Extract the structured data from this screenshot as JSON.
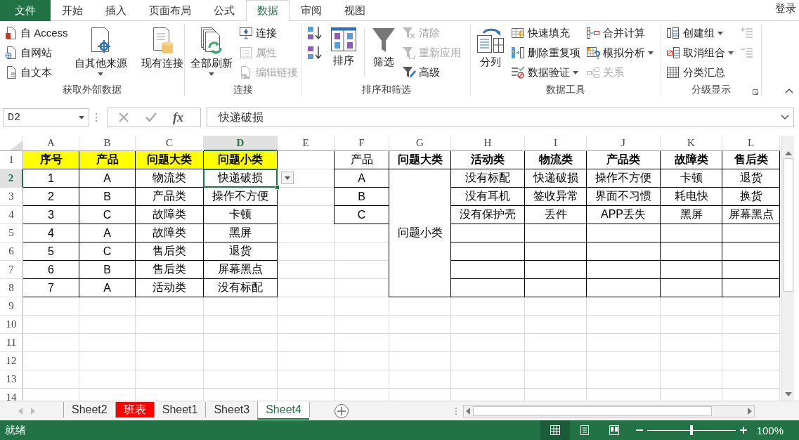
{
  "ribbon": {
    "tabs": [
      {
        "label": "文件",
        "kind": "file",
        "selected": false
      },
      {
        "label": "开始",
        "kind": "tab",
        "selected": false
      },
      {
        "label": "插入",
        "kind": "tab",
        "selected": false
      },
      {
        "label": "页面布局",
        "kind": "tab",
        "selected": false
      },
      {
        "label": "公式",
        "kind": "tab",
        "selected": false
      },
      {
        "label": "数据",
        "kind": "tab",
        "selected": true
      },
      {
        "label": "审阅",
        "kind": "tab",
        "selected": false
      },
      {
        "label": "视图",
        "kind": "tab",
        "selected": false
      }
    ],
    "account": "登录",
    "groups": [
      {
        "label": "获取外部数据",
        "items": [
          {
            "kind": "stack",
            "buttons": [
              {
                "label": "自 Access",
                "disabled": false,
                "dropdown": false
              },
              {
                "label": "自网站",
                "disabled": false,
                "dropdown": false
              },
              {
                "label": "自文本",
                "disabled": false,
                "dropdown": false
              }
            ]
          },
          {
            "kind": "large",
            "label": "自其他来源",
            "disabled": false,
            "dropdown": true
          },
          {
            "kind": "separator"
          },
          {
            "kind": "large",
            "label": "现有连接",
            "disabled": false,
            "dropdown": false
          }
        ]
      },
      {
        "label": "连接",
        "items": [
          {
            "kind": "large",
            "label": "全部刷新",
            "disabled": false,
            "dropdown": true
          },
          {
            "kind": "stack",
            "buttons": [
              {
                "label": "连接",
                "disabled": false,
                "dropdown": false
              },
              {
                "label": "属性",
                "disabled": true,
                "dropdown": false
              },
              {
                "label": "编辑链接",
                "disabled": true,
                "dropdown": false
              }
            ]
          }
        ]
      },
      {
        "label": "排序和筛选",
        "items": [
          {
            "kind": "stack",
            "buttons": [
              {
                "disabled": false,
                "dropdown": false
              },
              {
                "disabled": false,
                "dropdown": false
              }
            ]
          },
          {
            "kind": "large",
            "label": "排序",
            "disabled": false,
            "dropdown": false
          },
          {
            "kind": "separator"
          },
          {
            "kind": "large",
            "label": "筛选",
            "disabled": false,
            "dropdown": false
          },
          {
            "kind": "stack",
            "buttons": [
              {
                "label": "清除",
                "disabled": true,
                "dropdown": false
              },
              {
                "label": "重新应用",
                "disabled": true,
                "dropdown": false
              },
              {
                "label": "高级",
                "disabled": false,
                "dropdown": false
              }
            ]
          }
        ]
      },
      {
        "label": "数据工具",
        "items": [
          {
            "kind": "large",
            "label": "分列",
            "disabled": false,
            "dropdown": false
          },
          {
            "kind": "stack",
            "buttons": [
              {
                "label": "快速填充",
                "disabled": false,
                "dropdown": false
              },
              {
                "label": "删除重复项",
                "disabled": false,
                "dropdown": false
              },
              {
                "label": "数据验证",
                "disabled": false,
                "dropdown": true
              }
            ]
          },
          {
            "kind": "stack",
            "buttons": [
              {
                "label": "合并计算",
                "disabled": false,
                "dropdown": false
              },
              {
                "label": "模拟分析",
                "disabled": false,
                "dropdown": true
              },
              {
                "label": "关系",
                "disabled": true,
                "dropdown": false
              }
            ]
          }
        ]
      },
      {
        "label": "分级显示",
        "items": [
          {
            "kind": "stack",
            "buttons": [
              {
                "label": "创建组",
                "disabled": false,
                "dropdown": true
              },
              {
                "label": "取消组合",
                "disabled": false,
                "dropdown": true
              },
              {
                "label": "分类汇总",
                "disabled": false,
                "dropdown": false
              }
            ]
          },
          {
            "kind": "stack",
            "buttons": [
              {
                "disabled": true,
                "dropdown": false
              },
              {
                "disabled": true,
                "dropdown": false
              }
            ]
          }
        ]
      }
    ]
  },
  "formula_bar": {
    "name_box": "D2",
    "function_label": "fx",
    "value": "快递破损"
  },
  "sheet": {
    "validation_dropdown": true,
    "columns": [
      {
        "label": "A",
        "selected": false
      },
      {
        "label": "B",
        "selected": false
      },
      {
        "label": "C",
        "selected": false
      },
      {
        "label": "D",
        "selected": true
      },
      {
        "label": "E",
        "selected": false
      },
      {
        "label": "F",
        "selected": false
      },
      {
        "label": "G",
        "selected": false
      },
      {
        "label": "H",
        "selected": false
      },
      {
        "label": "I",
        "selected": false
      },
      {
        "label": "J",
        "selected": false
      },
      {
        "label": "K",
        "selected": false
      },
      {
        "label": "L",
        "selected": false
      }
    ],
    "rows": [
      {
        "label": "1",
        "selected": false,
        "cells": [
          {
            "kind": "header",
            "text": "序号",
            "selected": false
          },
          {
            "kind": "header",
            "text": "产品",
            "selected": false
          },
          {
            "kind": "header",
            "text": "问题大类",
            "selected": false
          },
          {
            "kind": "header",
            "text": "问题小类",
            "selected": false
          },
          {
            "kind": "blank",
            "selected": false
          },
          {
            "kind": "table",
            "text": "产品",
            "selected": false
          },
          {
            "kind": "table-header",
            "text": "问题大类",
            "selected": false
          },
          {
            "kind": "table-header",
            "text": "活动类",
            "selected": false
          },
          {
            "kind": "table-header",
            "text": "物流类",
            "selected": false
          },
          {
            "kind": "table-header",
            "text": "产品类",
            "selected": false
          },
          {
            "kind": "table-header",
            "text": "故障类",
            "selected": false
          },
          {
            "kind": "table-header",
            "text": "售后类",
            "selected": false
          }
        ]
      },
      {
        "label": "2",
        "selected": true,
        "cells": [
          {
            "kind": "table",
            "text": "1",
            "selected": false
          },
          {
            "kind": "table",
            "text": "A",
            "selected": false
          },
          {
            "kind": "table",
            "text": "物流类",
            "selected": false
          },
          {
            "kind": "table",
            "text": "快递破损",
            "selected": true
          },
          {
            "kind": "blank",
            "selected": false
          },
          {
            "kind": "table",
            "text": "A",
            "selected": false
          },
          {
            "kind": "merged",
            "text": "问题小类",
            "selected": false
          },
          {
            "kind": "table",
            "text": "没有标配",
            "selected": false
          },
          {
            "kind": "table",
            "text": "快递破损",
            "selected": false
          },
          {
            "kind": "table",
            "text": "操作不方便",
            "selected": false
          },
          {
            "kind": "table",
            "text": "卡顿",
            "selected": false
          },
          {
            "kind": "table",
            "text": "退货",
            "selected": false
          }
        ]
      },
      {
        "label": "3",
        "selected": false,
        "cells": [
          {
            "kind": "table",
            "text": "2",
            "selected": false
          },
          {
            "kind": "table",
            "text": "B",
            "selected": false
          },
          {
            "kind": "table",
            "text": "产品类",
            "selected": false
          },
          {
            "kind": "table",
            "text": "操作不方便",
            "selected": false
          },
          {
            "kind": "blank",
            "selected": false
          },
          {
            "kind": "table",
            "text": "B",
            "selected": false
          },
          {
            "kind": "covered"
          },
          {
            "kind": "table",
            "text": "没有耳机",
            "selected": false
          },
          {
            "kind": "table",
            "text": "签收异常",
            "selected": false
          },
          {
            "kind": "table",
            "text": "界面不习惯",
            "selected": false
          },
          {
            "kind": "table",
            "text": "耗电快",
            "selected": false
          },
          {
            "kind": "table",
            "text": "换货",
            "selected": false
          }
        ]
      },
      {
        "label": "4",
        "selected": false,
        "cells": [
          {
            "kind": "table",
            "text": "3",
            "selected": false
          },
          {
            "kind": "table",
            "text": "C",
            "selected": false
          },
          {
            "kind": "table",
            "text": "故障类",
            "selected": false
          },
          {
            "kind": "table",
            "text": "卡顿",
            "selected": false
          },
          {
            "kind": "blank",
            "selected": false
          },
          {
            "kind": "table",
            "text": "C",
            "selected": false
          },
          {
            "kind": "covered"
          },
          {
            "kind": "table",
            "text": "没有保护壳",
            "selected": false
          },
          {
            "kind": "table",
            "text": "丢件",
            "selected": false
          },
          {
            "kind": "table",
            "text": "APP丢失",
            "selected": false
          },
          {
            "kind": "table",
            "text": "黑屏",
            "selected": false
          },
          {
            "kind": "table",
            "text": "屏幕黑点",
            "selected": false
          }
        ]
      },
      {
        "label": "5",
        "selected": false,
        "cells": [
          {
            "kind": "table",
            "text": "4",
            "selected": false
          },
          {
            "kind": "table",
            "text": "A",
            "selected": false
          },
          {
            "kind": "table",
            "text": "故障类",
            "selected": false
          },
          {
            "kind": "table",
            "text": "黑屏",
            "selected": false
          },
          {
            "kind": "blank",
            "selected": false
          },
          {
            "kind": "blank",
            "selected": false
          },
          {
            "kind": "covered"
          },
          {
            "kind": "table"
          },
          {
            "kind": "table"
          },
          {
            "kind": "table"
          },
          {
            "kind": "table"
          },
          {
            "kind": "table"
          }
        ]
      },
      {
        "label": "6",
        "selected": false,
        "cells": [
          {
            "kind": "table",
            "text": "5",
            "selected": false
          },
          {
            "kind": "table",
            "text": "C",
            "selected": false
          },
          {
            "kind": "table",
            "text": "售后类",
            "selected": false
          },
          {
            "kind": "table",
            "text": "退货",
            "selected": false
          },
          {
            "kind": "blank",
            "selected": false
          },
          {
            "kind": "blank",
            "selected": false
          },
          {
            "kind": "covered"
          },
          {
            "kind": "table"
          },
          {
            "kind": "table"
          },
          {
            "kind": "table"
          },
          {
            "kind": "table"
          },
          {
            "kind": "table"
          }
        ]
      },
      {
        "label": "7",
        "selected": false,
        "cells": [
          {
            "kind": "table",
            "text": "6",
            "selected": false
          },
          {
            "kind": "table",
            "text": "B",
            "selected": false
          },
          {
            "kind": "table",
            "text": "售后类",
            "selected": false
          },
          {
            "kind": "table",
            "text": "屏幕黑点",
            "selected": false
          },
          {
            "kind": "blank",
            "selected": false
          },
          {
            "kind": "blank",
            "selected": false
          },
          {
            "kind": "covered"
          },
          {
            "kind": "table"
          },
          {
            "kind": "table"
          },
          {
            "kind": "table"
          },
          {
            "kind": "table"
          },
          {
            "kind": "table"
          }
        ]
      },
      {
        "label": "8",
        "selected": false,
        "cells": [
          {
            "kind": "table",
            "text": "7",
            "selected": false
          },
          {
            "kind": "table",
            "text": "A",
            "selected": false
          },
          {
            "kind": "table",
            "text": "活动类",
            "selected": false
          },
          {
            "kind": "table",
            "text": "没有标配",
            "selected": false
          },
          {
            "kind": "blank",
            "selected": false
          },
          {
            "kind": "blank",
            "selected": false
          },
          {
            "kind": "covered"
          },
          {
            "kind": "table"
          },
          {
            "kind": "table"
          },
          {
            "kind": "table"
          },
          {
            "kind": "table"
          },
          {
            "kind": "table"
          }
        ]
      },
      {
        "label": "9",
        "selected": false
      },
      {
        "label": "10",
        "selected": false
      },
      {
        "label": "11",
        "selected": false
      },
      {
        "label": "12",
        "selected": false
      },
      {
        "label": "13",
        "selected": false
      },
      {
        "label": "14",
        "selected": false
      }
    ]
  },
  "sheet_tabs": [
    {
      "label": "Sheet2",
      "selected": false
    },
    {
      "label": "班表",
      "selected": false,
      "color": "#ff0000"
    },
    {
      "label": "Sheet1",
      "selected": false
    },
    {
      "label": "Sheet3",
      "selected": false
    },
    {
      "label": "Sheet4",
      "selected": true
    }
  ],
  "status_bar": {
    "status": "就绪",
    "views": [
      {
        "selected": true
      },
      {
        "selected": false
      },
      {
        "selected": false
      }
    ],
    "zoom": {
      "level": 0.5,
      "reading": "100%"
    }
  }
}
